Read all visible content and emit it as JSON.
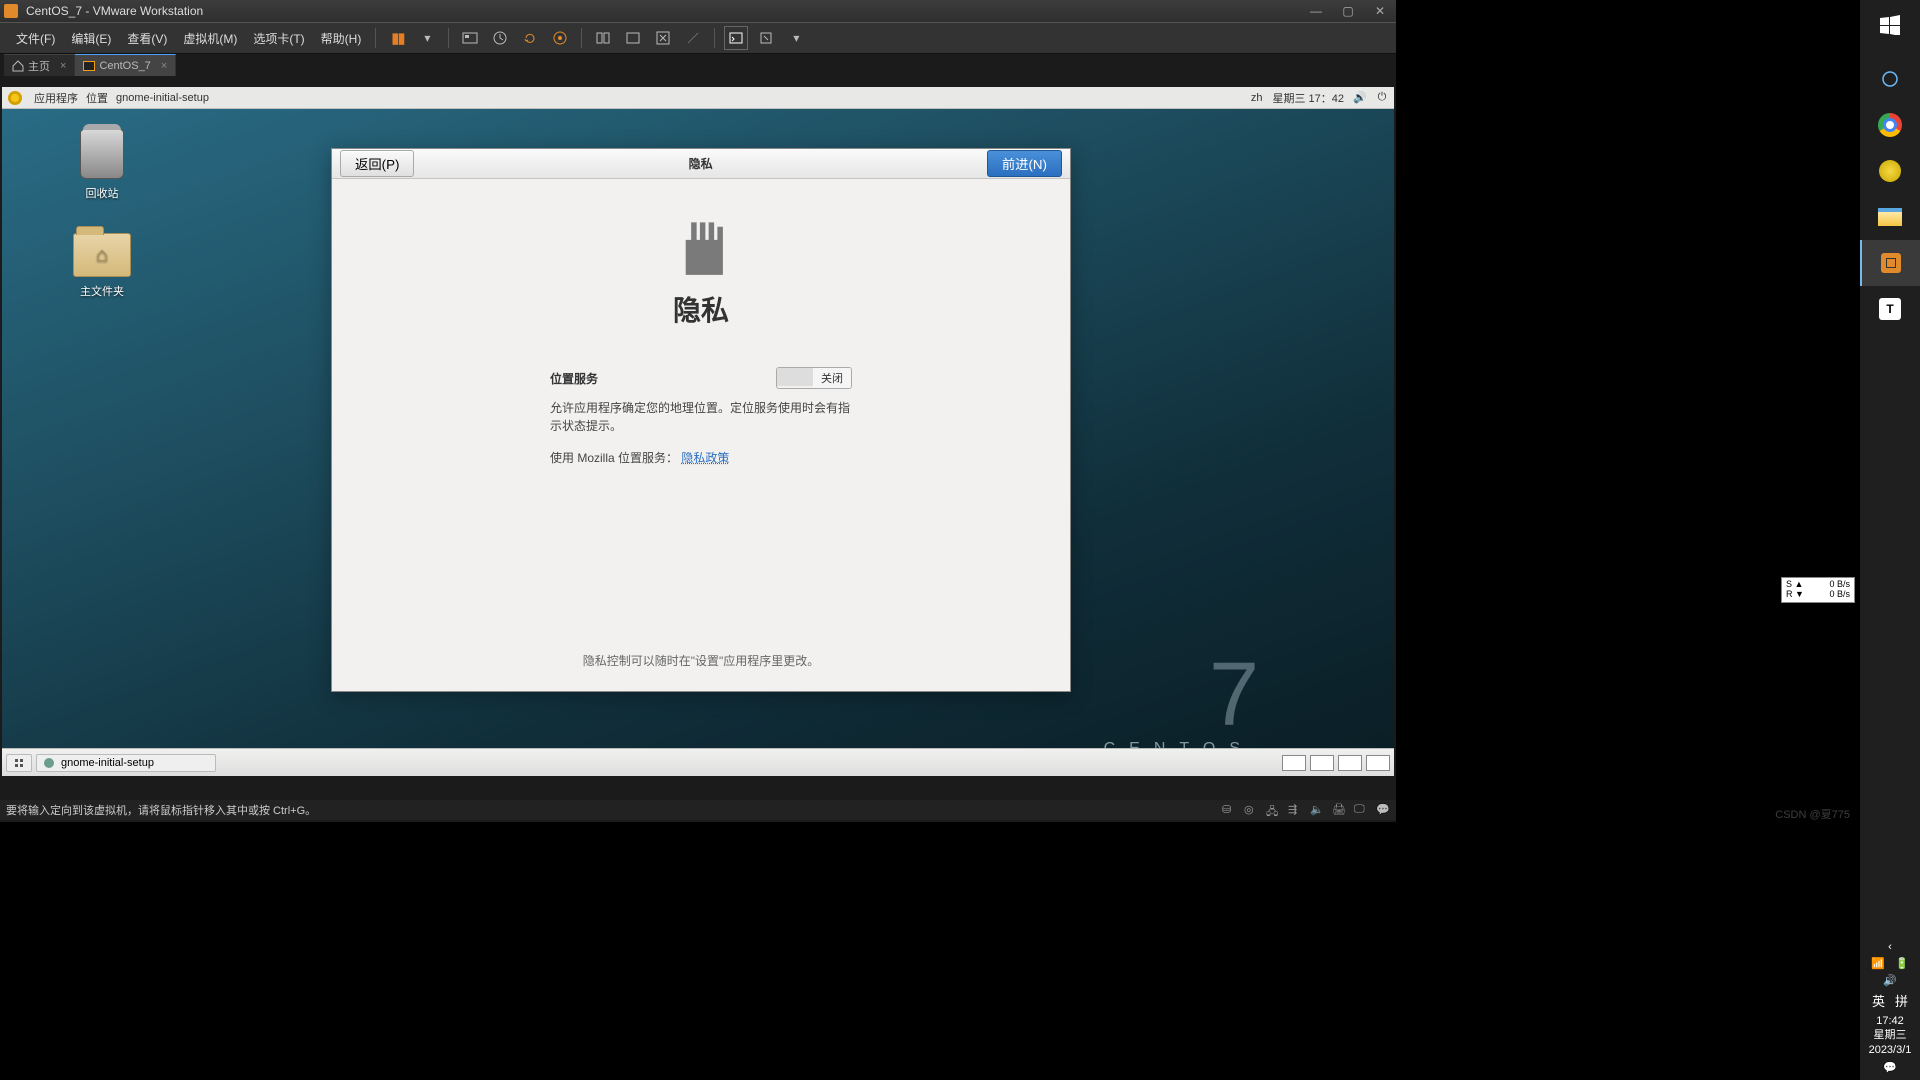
{
  "vmware": {
    "title": "CentOS_7 - VMware Workstation",
    "menu": [
      "文件(F)",
      "编辑(E)",
      "查看(V)",
      "虚拟机(M)",
      "选项卡(T)",
      "帮助(H)"
    ],
    "tabs": {
      "home": "主页",
      "active": "CentOS_7"
    },
    "hint": "要将输入定向到该虚拟机，请将鼠标指针移入其中或按 Ctrl+G。"
  },
  "gnome": {
    "apps": "应用程序",
    "places": "位置",
    "current": "gnome-initial-setup",
    "lang": "zh",
    "clock": "星期三 17：42",
    "desktop": {
      "trash": "回收站",
      "home": "主文件夹"
    },
    "brand": "CENTOS",
    "brand_ver": "7",
    "taskbar_item": "gnome-initial-setup"
  },
  "dialog": {
    "back": "返回(P)",
    "forward": "前进(N)",
    "title": "隐私",
    "heading": "隐私",
    "loc_label": "位置服务",
    "switch_off": "关闭",
    "desc": "允许应用程序确定您的地理位置。定位服务使用时会有指示状态提示。",
    "svc_prefix": "使用 Mozilla 位置服务：",
    "svc_link": "隐私政策",
    "footer": "隐私控制可以随时在\"设置\"应用程序里更改。"
  },
  "netwidget": {
    "s": "S ▲",
    "r": "R ▼",
    "sv": "0 B/s",
    "rv": "0 B/s"
  },
  "win": {
    "ime1": "英",
    "ime2": "拼",
    "time": "17:42",
    "day": "星期三",
    "date": "2023/3/1"
  },
  "watermark": "CSDN @夏775"
}
